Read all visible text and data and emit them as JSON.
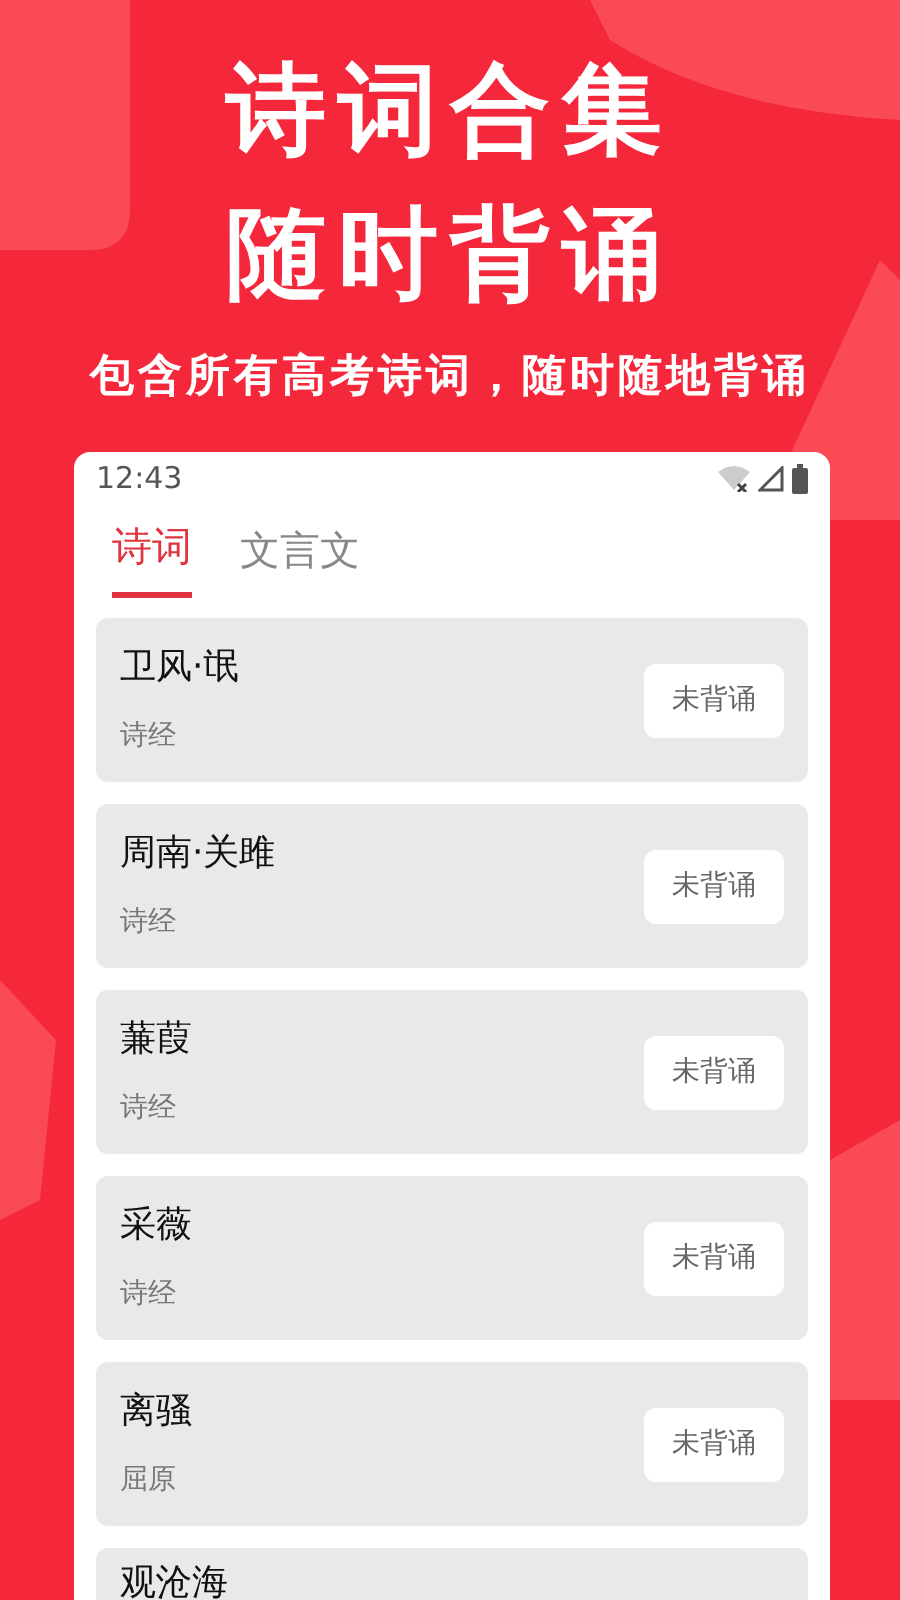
{
  "headline": [
    "诗词合集",
    "随时背诵"
  ],
  "tagline": "包含所有高考诗词，随时随地背诵",
  "status_bar": {
    "time": "12:43"
  },
  "tabs": [
    {
      "label": "诗词",
      "selected": true
    },
    {
      "label": "文言文",
      "selected": false
    }
  ],
  "poems": [
    {
      "title": "卫风·氓",
      "author": "诗经",
      "button": "未背诵"
    },
    {
      "title": "周南·关雎",
      "author": "诗经",
      "button": "未背诵"
    },
    {
      "title": "蒹葭",
      "author": "诗经",
      "button": "未背诵"
    },
    {
      "title": "采薇",
      "author": "诗经",
      "button": "未背诵"
    },
    {
      "title": "离骚",
      "author": "屈原",
      "button": "未背诵"
    },
    {
      "title": "观沧海"
    }
  ]
}
